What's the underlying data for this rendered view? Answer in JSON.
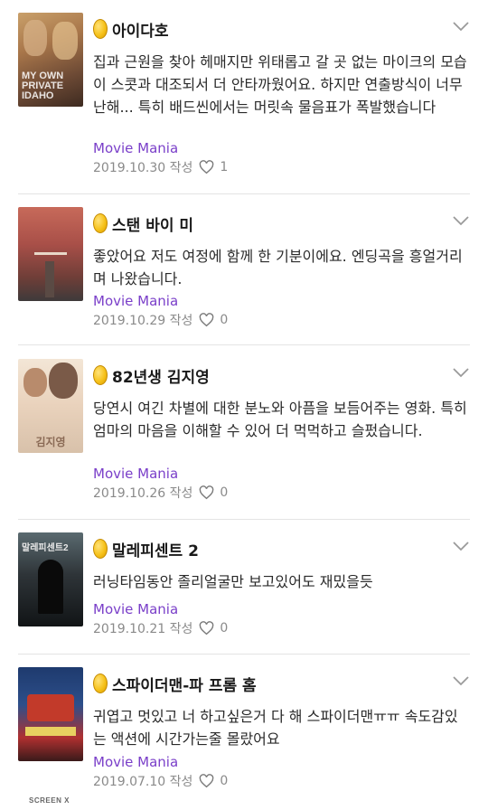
{
  "reviews": [
    {
      "title": "아이다호",
      "text": "집과 근원을 찾아 헤매지만 위태롭고 갈 곳 없는 마이크의 모습이 스콧과 대조되서 더 안타까웠어요. 하지만 연출방식이 너무 난해... 특히 배드씬에서는 머릿속 물음표가 폭발했습니다",
      "source": "Movie Mania",
      "date": "2019.10.30 작성",
      "likes": "1",
      "poster_label": "MY OWN PRIVATE IDAHO"
    },
    {
      "title": "스탠 바이 미",
      "text": "좋았어요 저도 여정에 함께 한 기분이에요. 엔딩곡을 흥얼거리며 나왔습니다.",
      "source": "Movie Mania",
      "date": "2019.10.29 작성",
      "likes": "0",
      "poster_label": ""
    },
    {
      "title": "82년생 김지영",
      "text": "당연시 여긴 차별에 대한 분노와 아픔을 보듬어주는 영화. 특히 엄마의 마음을 이해할 수 있어 더 먹먹하고 슬펐습니다.",
      "source": "Movie Mania",
      "date": "2019.10.26 작성",
      "likes": "0",
      "poster_label": "김지영"
    },
    {
      "title": "말레피센트 2",
      "text": "러닝타임동안 졸리얼굴만 보고있어도 재밌을듯",
      "source": "Movie Mania",
      "date": "2019.10.21 작성",
      "likes": "0",
      "poster_label": "말레피센트2"
    },
    {
      "title": "스파이더맨-파 프롬 홈",
      "text": "귀엽고 멋있고 너 하고싶은거 다 해 스파이더맨ㅠㅠ 속도감있는 액션에 시간가는줄 몰랐어요",
      "source": "Movie Mania",
      "date": "2019.07.10 작성",
      "likes": "0",
      "poster_label": "SCREEN X"
    }
  ],
  "colors": {
    "accent_purple": "#7a3fc9",
    "meta_gray": "#8a8a8a",
    "badge_gold": "#f6c21a"
  }
}
